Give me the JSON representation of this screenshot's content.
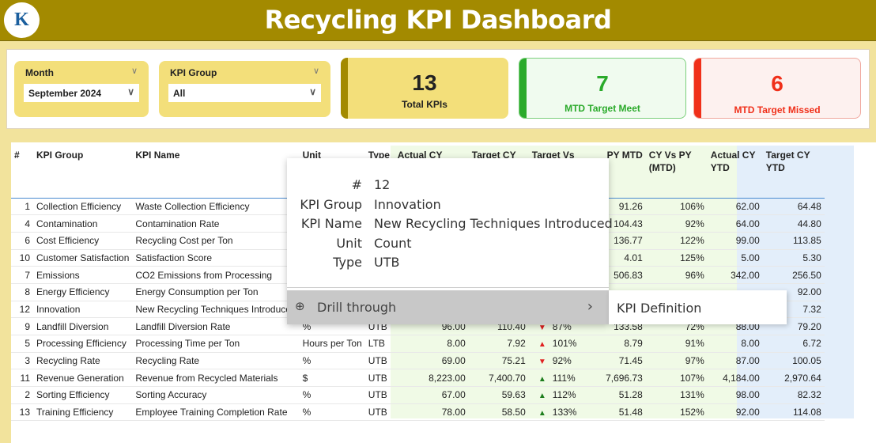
{
  "header": {
    "title": "Recycling KPI Dashboard",
    "logo_text": "K"
  },
  "filters": {
    "month": {
      "label": "Month",
      "value": "September 2024"
    },
    "kpi_group": {
      "label": "KPI Group",
      "value": "All"
    }
  },
  "cards": [
    {
      "value": "13",
      "label": "Total KPIs",
      "color": "#a38a00"
    },
    {
      "value": "7",
      "label": "MTD Target Meet",
      "color": "#2aaa2a"
    },
    {
      "value": "6",
      "label": "MTD Target Missed",
      "color": "#f0301a"
    }
  ],
  "table": {
    "columns": [
      "#",
      "KPI Group",
      "KPI Name",
      "Unit",
      "Type",
      "Actual CY",
      "Target CY",
      "Target Vs",
      "PY MTD",
      "CY Vs PY (MTD)",
      "Actual CY YTD",
      "Target CY YTD"
    ],
    "rows": [
      [
        "1",
        "Collection Efficiency",
        "Waste Collection Efficiency",
        null,
        null,
        null,
        null,
        null,
        null,
        "91.26",
        "106%",
        "62.00",
        "64.48"
      ],
      [
        "4",
        "Contamination",
        "Contamination Rate",
        null,
        null,
        null,
        null,
        null,
        null,
        "104.43",
        "92%",
        "64.00",
        "44.80"
      ],
      [
        "6",
        "Cost Efficiency",
        "Recycling Cost per Ton",
        null,
        null,
        null,
        null,
        null,
        null,
        "136.77",
        "122%",
        "99.00",
        "113.85"
      ],
      [
        "10",
        "Customer Satisfaction",
        "Satisfaction Score",
        null,
        null,
        null,
        null,
        null,
        null,
        "4.01",
        "125%",
        "5.00",
        "5.30"
      ],
      [
        "7",
        "Emissions",
        "CO2 Emissions from Processing",
        null,
        null,
        null,
        null,
        null,
        null,
        "506.83",
        "96%",
        "342.00",
        "256.50"
      ],
      [
        "8",
        "Energy Efficiency",
        "Energy Consumption per Ton",
        null,
        null,
        null,
        null,
        null,
        null,
        null,
        null,
        null,
        "92.00"
      ],
      [
        "12",
        "Innovation",
        "New Recycling Techniques Introduced",
        null,
        null,
        null,
        null,
        null,
        null,
        null,
        null,
        null,
        "7.32"
      ],
      [
        "9",
        "Landfill Diversion",
        "Landfill Diversion Rate",
        "%",
        "UTB",
        "96.00",
        "110.40",
        "down-red",
        "87%",
        "133.58",
        "72%",
        "88.00",
        "79.20"
      ],
      [
        "5",
        "Processing Efficiency",
        "Processing Time per Ton",
        "Hours per Ton",
        "LTB",
        "8.00",
        "7.92",
        "up-red",
        "101%",
        "8.79",
        "91%",
        "8.00",
        "6.72"
      ],
      [
        "3",
        "Recycling Rate",
        "Recycling Rate",
        "%",
        "UTB",
        "69.00",
        "75.21",
        "down-red",
        "92%",
        "71.45",
        "97%",
        "87.00",
        "100.05"
      ],
      [
        "11",
        "Revenue Generation",
        "Revenue from Recycled Materials",
        "$",
        "UTB",
        "8,223.00",
        "7,400.70",
        "up-green",
        "111%",
        "7,696.73",
        "107%",
        "4,184.00",
        "2,970.64"
      ],
      [
        "2",
        "Sorting Efficiency",
        "Sorting Accuracy",
        "%",
        "UTB",
        "67.00",
        "59.63",
        "up-green",
        "112%",
        "51.28",
        "131%",
        "98.00",
        "82.32"
      ],
      [
        "13",
        "Training Efficiency",
        "Employee Training Completion Rate",
        "%",
        "UTB",
        "78.00",
        "58.50",
        "up-green",
        "133%",
        "51.48",
        "152%",
        "92.00",
        "114.08"
      ]
    ]
  },
  "tooltip": {
    "fields": [
      {
        "k": "#",
        "v": "12"
      },
      {
        "k": "KPI Group",
        "v": "Innovation"
      },
      {
        "k": "KPI Name",
        "v": "New Recycling Techniques Introduced"
      },
      {
        "k": "Unit",
        "v": "Count"
      },
      {
        "k": "Type",
        "v": "UTB"
      }
    ],
    "drill_label": "Drill through",
    "submenu_item": "KPI Definition"
  }
}
